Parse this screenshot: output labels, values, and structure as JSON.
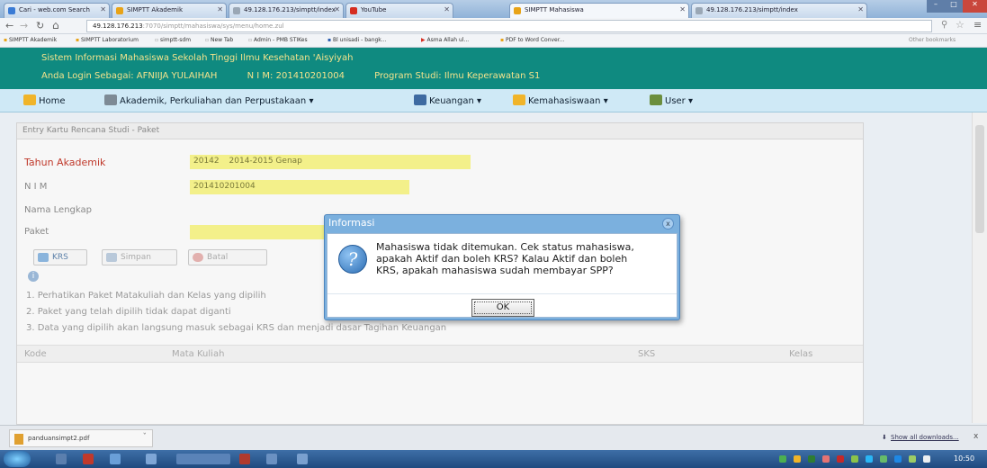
{
  "browser": {
    "tabs": [
      {
        "label": "Cari - web.com Search",
        "icon": "search-icon"
      },
      {
        "label": "SIMPTT Akademik",
        "icon": "app-icon"
      },
      {
        "label": "49.128.176.213/simptt/index",
        "icon": "page-icon"
      },
      {
        "label": "YouTube",
        "icon": "youtube-icon"
      },
      {
        "label": "SIMPTT Mahasiswa",
        "icon": "app-icon"
      },
      {
        "label": "49.128.176.213/simptt/index",
        "icon": "page-icon"
      }
    ],
    "url_host": "49.128.176.213",
    "url_path": ":7070/simptt/mahasiswa/sys/menu/home.zul",
    "bookmarks": [
      "SIMPTT Akademik",
      "SIMPTT Laboratorium",
      "simptt-sdm",
      "New Tab",
      "Admin - PMB STIKes",
      "Bl unisadi - bangk...",
      "Asma Allah ul...",
      "PDF to Word Conver..."
    ],
    "bookmarks_right": "Other bookmarks"
  },
  "header": {
    "line1": "Sistem Informasi Mahasiswa Sekolah Tinggi Ilmu Kesehatan 'Aisyiyah",
    "login_label": "Anda Login Sebagai:",
    "login_name": "AFNIIJA YULAIHAH",
    "nim_label": "N I M:",
    "nim_value": "201410201004",
    "prodi_label": "Program Studi:",
    "prodi_value": "Ilmu Keperawatan S1"
  },
  "menu": {
    "home": "Home",
    "akademik": "Akademik, Perkuliahan dan Perpustakaan",
    "keuangan": "Keuangan",
    "kemahasiswaan": "Kemahasiswaan",
    "user": "User"
  },
  "form": {
    "title": "Entry Kartu Rencana Studi - Paket",
    "tahun_label": "Tahun Akademik",
    "tahun_code": "20142",
    "tahun_text": "2014-2015 Genap",
    "nim_label": "N I M",
    "nim_value": "201410201004",
    "nama_label": "Nama Lengkap",
    "paket_label": "Paket",
    "btn_krs": "KRS",
    "btn_simpan": "Simpan",
    "btn_batal": "Batal",
    "notes": [
      "1. Perhatikan Paket Matakuliah dan Kelas yang dipilih",
      "2. Paket yang telah dipilih tidak dapat diganti",
      "3. Data yang dipilih akan langsung masuk sebagai KRS dan menjadi dasar Tagihan Keuangan"
    ],
    "grid_headers": [
      "Kode",
      "Mata Kuliah",
      "SKS",
      "Kelas"
    ]
  },
  "dialog": {
    "title": "Informasi",
    "message": "Mahasiswa tidak ditemukan. Cek status mahasiswa, apakah Aktif dan boleh KRS? Kalau Aktif dan boleh KRS, apakah mahasiswa sudah membayar SPP?",
    "ok": "OK",
    "close": "x"
  },
  "download": {
    "file": "panduansimpt2.pdf",
    "show_all": "Show all downloads...",
    "close": "x"
  },
  "taskbar": {
    "time": "10:50"
  }
}
